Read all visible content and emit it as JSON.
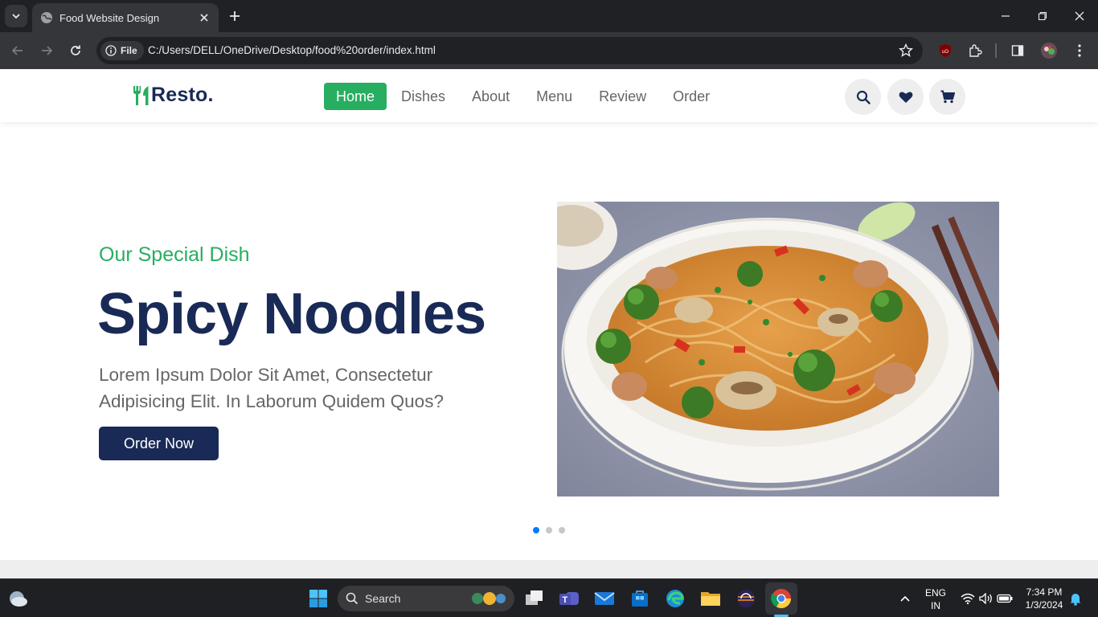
{
  "browser": {
    "tab_title": "Food Website Design",
    "chip_label": "File",
    "url": "C:/Users/DELL/OneDrive/Desktop/food%20order/index.html"
  },
  "site": {
    "logo_text": "Resto.",
    "nav": [
      {
        "label": "Home",
        "active": true
      },
      {
        "label": "Dishes"
      },
      {
        "label": "About"
      },
      {
        "label": "Menu"
      },
      {
        "label": "Review"
      },
      {
        "label": "Order"
      }
    ],
    "header_icons": [
      "search-icon",
      "heart-icon",
      "cart-icon"
    ],
    "accent_color": "#27ae60",
    "navy_color": "#192a56"
  },
  "hero": {
    "subtitle": "Our Special Dish",
    "title": "Spicy Noodles",
    "text": "Lorem Ipsum Dolor Sit Amet, Consectetur Adipisicing Elit. In Laborum Quidem Quos?",
    "button_label": "Order Now",
    "slide_count": 3,
    "active_slide": 1
  },
  "taskbar": {
    "search_label": "Search",
    "lang_line1": "ENG",
    "lang_line2": "IN",
    "time": "7:34 PM",
    "date": "1/3/2024"
  }
}
